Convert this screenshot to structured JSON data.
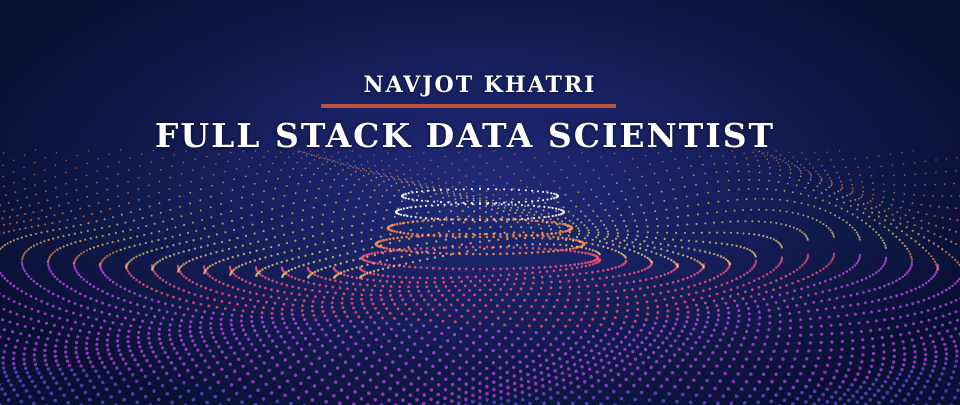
{
  "header": {
    "name": "NAVJOT KHATRI",
    "role": "FULL STACK DATA SCIENTIST"
  },
  "colors": {
    "background": "#111a4d",
    "accent_rule": "#c0503b",
    "text": "#ffffff",
    "particle_palette": [
      "#ffd36b",
      "#ff8a4c",
      "#ff4f7b",
      "#d24cff",
      "#7d5cff",
      "#ffffff"
    ]
  }
}
